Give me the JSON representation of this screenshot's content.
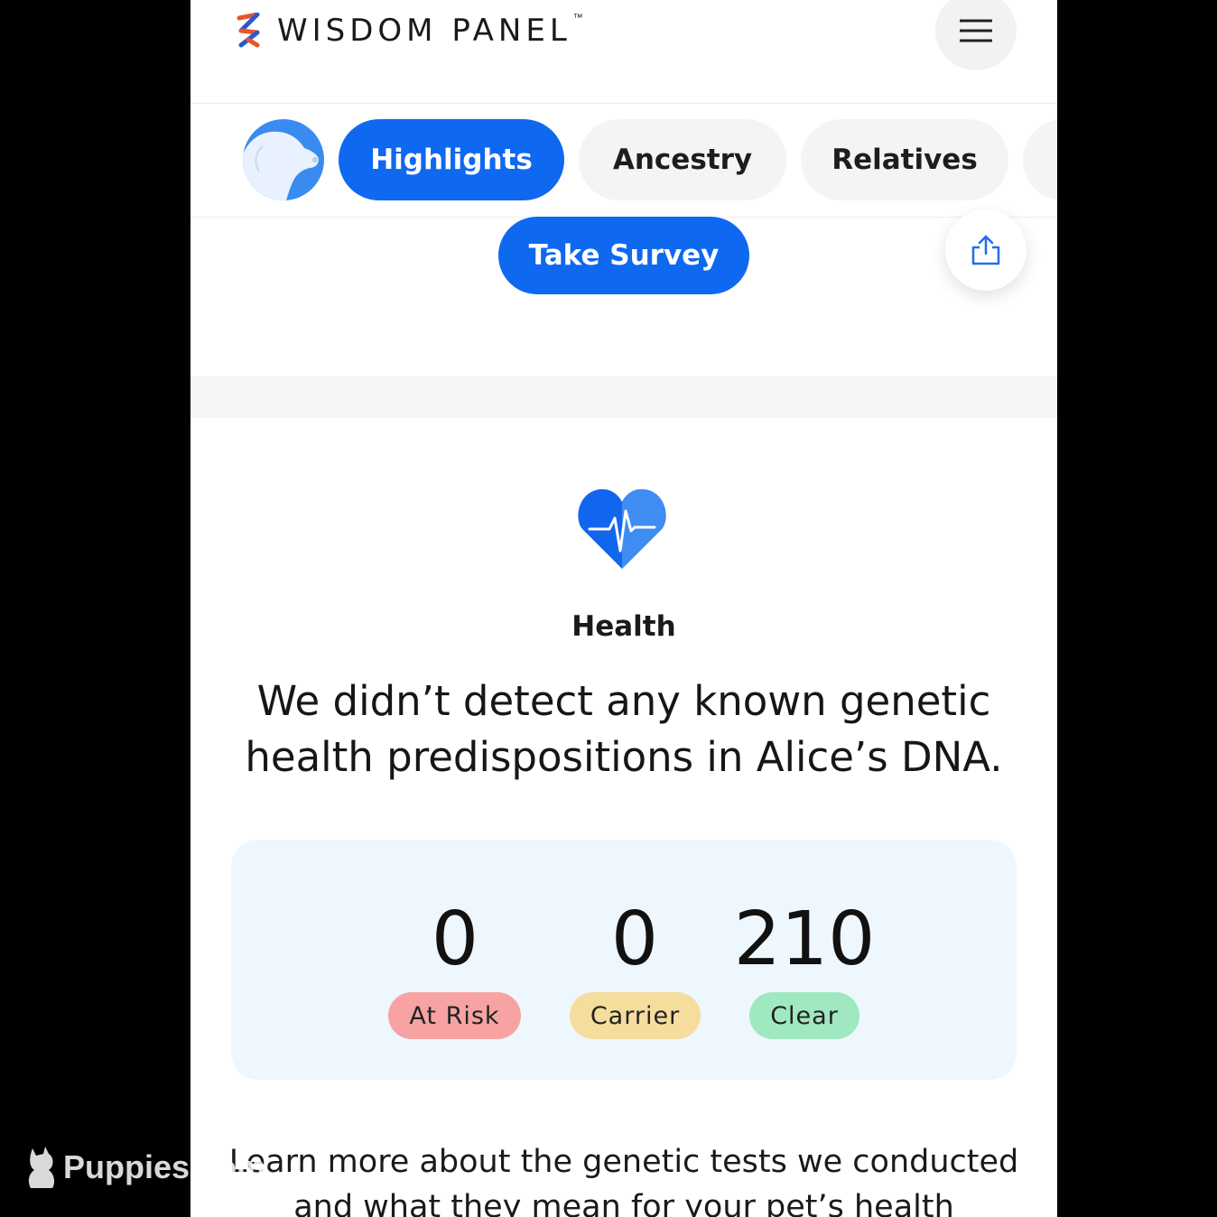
{
  "header": {
    "brand": "WISDOM PANEL",
    "trademark": "™",
    "menu_icon": "hamburger-menu-icon"
  },
  "tabs": [
    {
      "label": "Highlights",
      "active": true
    },
    {
      "label": "Ancestry",
      "active": false
    },
    {
      "label": "Relatives",
      "active": false
    }
  ],
  "survey": {
    "button_label": "Take Survey",
    "share_icon": "share-icon"
  },
  "health": {
    "icon": "heart-pulse-icon",
    "label": "Health",
    "headline": "We didn’t detect any known genetic health predispositions in Alice’s DNA.",
    "stats": [
      {
        "value": "0",
        "label": "At Risk",
        "color": "#f7a3a3"
      },
      {
        "value": "0",
        "label": "Carrier",
        "color": "#f5dd9e"
      },
      {
        "value": "210",
        "label": "Clear",
        "color": "#9fe8c0"
      }
    ],
    "learn_more": "Learn more about the genetic tests we conducted and what they mean for your pet’s health"
  },
  "colors": {
    "accent": "#0f68f0",
    "card_bg": "#eef7fd"
  },
  "watermark": {
    "text": "Puppies.com"
  }
}
